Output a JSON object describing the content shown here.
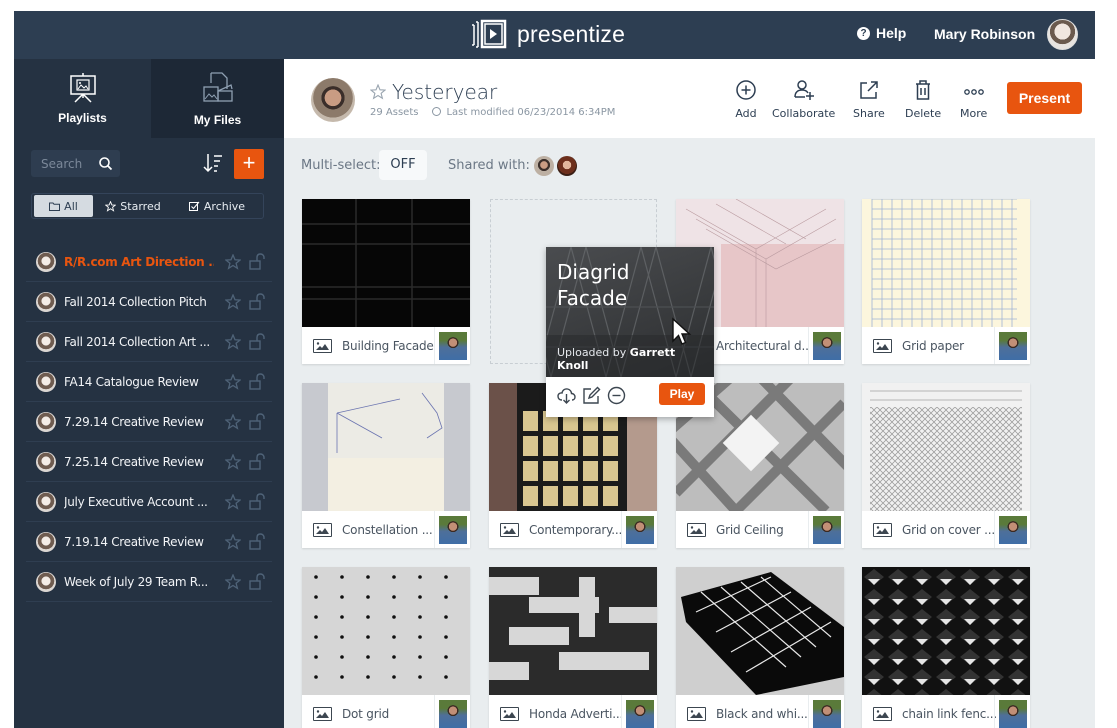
{
  "app": {
    "name": "presentize",
    "help_label": "Help",
    "user_name": "Mary Robinson"
  },
  "sidebar": {
    "tabs": [
      {
        "label": "Playlists",
        "icon": "presentation-board-icon",
        "active": false
      },
      {
        "label": "My Files",
        "icon": "media-files-icon",
        "active": true
      }
    ],
    "search_placeholder": "Search",
    "add_label": "+",
    "filters": [
      {
        "label": "All",
        "icon": "folder-icon",
        "selected": true
      },
      {
        "label": "Starred",
        "icon": "star-icon",
        "selected": false
      },
      {
        "label": "Archive",
        "icon": "checkbox-icon",
        "selected": false
      }
    ],
    "playlists": [
      {
        "label": "R/R.com Art Direction ...",
        "active": true
      },
      {
        "label": "Fall 2014 Collection Pitch",
        "active": false
      },
      {
        "label": "Fall 2014 Collection Art ...",
        "active": false
      },
      {
        "label": "FA14 Catalogue Review",
        "active": false
      },
      {
        "label": "7.29.14 Creative Review",
        "active": false
      },
      {
        "label": "7.25.14 Creative Review",
        "active": false
      },
      {
        "label": "July Executive Account ...",
        "active": false
      },
      {
        "label": "7.19.14 Creative Review",
        "active": false
      },
      {
        "label": "Week of July 29 Team R...",
        "active": false
      }
    ]
  },
  "header": {
    "title": "Yesteryear",
    "assets": "29 Assets",
    "last_modified": "Last modified 06/23/2014 6:34PM",
    "toolbar": [
      {
        "label": "Add",
        "icon": "add-circle-icon"
      },
      {
        "label": "Collaborate",
        "icon": "add-user-icon"
      },
      {
        "label": "Share",
        "icon": "share-external-icon"
      },
      {
        "label": "Delete",
        "icon": "trash-icon"
      },
      {
        "label": "More",
        "icon": "more-dots-icon"
      }
    ],
    "present_label": "Present"
  },
  "subbar": {
    "multiselect_label": "Multi-select:",
    "multiselect_value": "OFF",
    "shared_label": "Shared with:"
  },
  "assets": [
    {
      "caption": "Building Facade",
      "thumb": "dark-grid"
    },
    {
      "caption": "Architectural d...",
      "thumb": "pink-iso"
    },
    {
      "caption": "Grid paper",
      "thumb": "grid-paper"
    },
    {
      "caption": "Constellation ...",
      "thumb": "constellation"
    },
    {
      "caption": "Contemporary...",
      "thumb": "building"
    },
    {
      "caption": "Grid Ceiling",
      "thumb": "ceiling"
    },
    {
      "caption": "Grid on cover ...",
      "thumb": "chainlink-light"
    },
    {
      "caption": "Dot grid",
      "thumb": "dots"
    },
    {
      "caption": "Honda Adverti...",
      "thumb": "maze"
    },
    {
      "caption": "Black and whi...",
      "thumb": "black-box"
    },
    {
      "caption": "chain link fenc...",
      "thumb": "diamond-dark"
    }
  ],
  "popup": {
    "title": "Diagrid Facade",
    "uploaded_prefix": "Uploaded by",
    "uploaded_by": "Garrett Knoll",
    "play_label": "Play"
  },
  "colors": {
    "accent": "#e8550f",
    "topbar": "#2d3e52",
    "sidebar": "#253242",
    "main_bg": "#e9edef"
  }
}
